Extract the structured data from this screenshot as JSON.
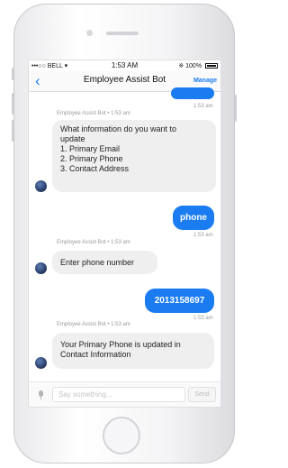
{
  "status_bar": {
    "carrier": "•••○○ BELL",
    "wifi_icon": "wifi-icon",
    "time": "1:53 AM",
    "battery": "100%"
  },
  "header": {
    "back_icon": "chevron-left-icon",
    "title": "Employee Assist Bot",
    "manage_label": "Manage"
  },
  "messages": [
    {
      "from": "user",
      "text": "",
      "time": "1:53 am"
    },
    {
      "from": "bot",
      "meta": "Employee Assist Bot • 1:53 am",
      "lines": [
        "What information do you want to",
        "update",
        "1. Primary Email",
        "2. Primary Phone",
        "3. Contact Address"
      ]
    },
    {
      "from": "user",
      "text": "phone",
      "time": "1:53 am"
    },
    {
      "from": "bot",
      "meta": "Employee Assist Bot • 1:53 am",
      "lines": [
        "Enter phone number"
      ]
    },
    {
      "from": "user",
      "text": "2013158697",
      "time": "1:53 am"
    },
    {
      "from": "bot",
      "meta": "Employee Assist Bot • 1:53 am",
      "lines": [
        "Your Primary Phone is updated in",
        "Contact Information"
      ]
    }
  ],
  "composer": {
    "mic_icon": "microphone-icon",
    "placeholder": "Say something...",
    "send_label": "Send"
  },
  "colors": {
    "accent": "#1a7cf0",
    "bot_bubble": "#efefef",
    "phone_frame": "#f4f4f6"
  }
}
